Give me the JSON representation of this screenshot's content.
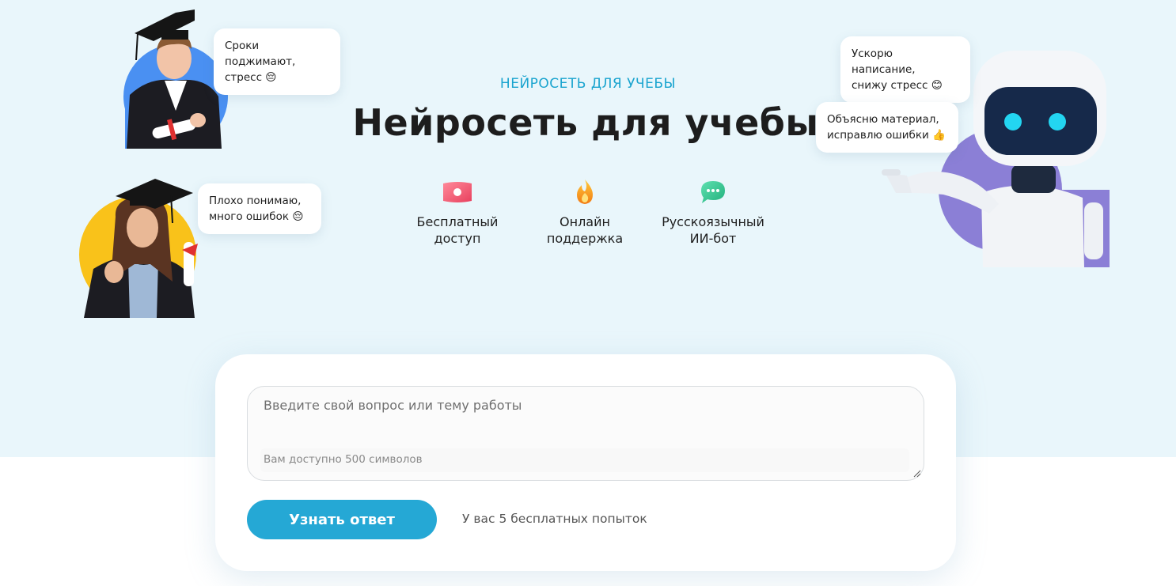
{
  "header": {
    "eyebrow": "НЕЙРОСЕТЬ ДЛЯ УЧЕБЫ",
    "title": "Нейросеть для учебы"
  },
  "features": [
    {
      "icon": "banknote-icon",
      "line1": "Бесплатный",
      "line2": "доступ",
      "color": "#f05a7a"
    },
    {
      "icon": "flame-icon",
      "line1": "Онлайн",
      "line2": "поддержка",
      "color": "#f7a21b"
    },
    {
      "icon": "chat-bubble-icon",
      "line1": "Русскоязычный",
      "line2": "ИИ-бот",
      "color": "#2cc58f"
    }
  ],
  "bubbles": {
    "student_top": {
      "line1": "Сроки поджимают,",
      "line2": "стресс 😔"
    },
    "student_bottom": {
      "line1": "Плохо понимаю,",
      "line2": "много ошибок 😔"
    },
    "robot_top": {
      "line1": "Ускорю написание,",
      "line2": "снижу стресс 😊"
    },
    "robot_bottom": {
      "line1": "Объясню материал,",
      "line2": "исправлю ошибки 👍"
    }
  },
  "form": {
    "placeholder": "Введите свой вопрос или тему работы",
    "chars_note": "Вам доступно 500 символов",
    "submit_label": "Узнать ответ",
    "attempts_text": "У вас 5 бесплатных попыток"
  },
  "colors": {
    "accent": "#25a8d5",
    "hero_background": "#e9f6fb",
    "avatar_blue": "#4a90f2",
    "avatar_yellow": "#f9c21a",
    "avatar_purple": "#8b7fd6"
  }
}
